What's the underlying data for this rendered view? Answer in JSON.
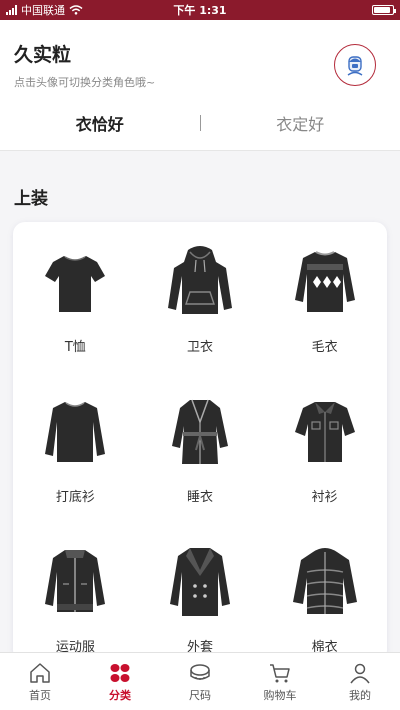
{
  "status": {
    "carrier": "中国联通",
    "time": "下午 1:31"
  },
  "profile": {
    "name": "久实粒",
    "hint": "点击头像可切换分类角色哦~"
  },
  "tabs": [
    {
      "label": "衣恰好"
    },
    {
      "label": "衣定好"
    }
  ],
  "section": {
    "title": "上装"
  },
  "items": [
    {
      "label": "T恤",
      "icon": "tshirt-icon"
    },
    {
      "label": "卫衣",
      "icon": "hoodie-icon"
    },
    {
      "label": "毛衣",
      "icon": "sweater-icon"
    },
    {
      "label": "打底衫",
      "icon": "longsleeve-icon"
    },
    {
      "label": "睡衣",
      "icon": "robe-icon"
    },
    {
      "label": "衬衫",
      "icon": "shirt-icon"
    },
    {
      "label": "运动服",
      "icon": "track-jacket-icon"
    },
    {
      "label": "外套",
      "icon": "coat-icon"
    },
    {
      "label": "棉衣",
      "icon": "puffer-icon"
    }
  ],
  "nav": [
    {
      "label": "首页",
      "icon": "home-icon"
    },
    {
      "label": "分类",
      "icon": "category-icon"
    },
    {
      "label": "尺码",
      "icon": "measure-tape-icon"
    },
    {
      "label": "购物车",
      "icon": "cart-icon"
    },
    {
      "label": "我的",
      "icon": "user-icon"
    }
  ],
  "colors": {
    "brand": "#8b1a2c",
    "accent": "#c8102e",
    "garment": "#2b2b2b"
  }
}
